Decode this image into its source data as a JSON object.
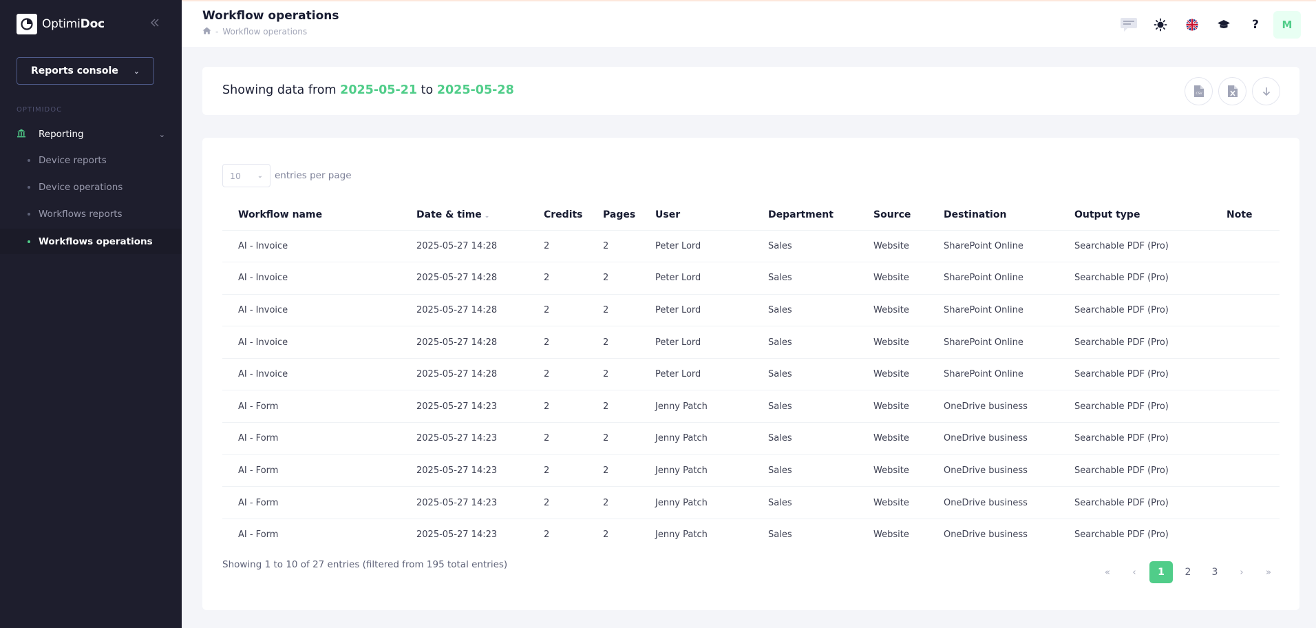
{
  "sidebar": {
    "brand_light": "Optimi",
    "brand_bold": "Doc",
    "console_label": "Reports console",
    "section_label": "OPTIMIDOC",
    "parent_label": "Reporting",
    "items": [
      {
        "label": "Device reports"
      },
      {
        "label": "Device operations"
      },
      {
        "label": "Workflows reports"
      },
      {
        "label": "Workflows operations",
        "active": true
      }
    ]
  },
  "header": {
    "title": "Workflow operations",
    "breadcrumb_sep": "-",
    "breadcrumb_current": "Workflow operations",
    "help_label": "?",
    "avatar_initial": "M"
  },
  "date_range": {
    "prefix": "Showing data from",
    "from": "2025-05-21",
    "mid": "to",
    "to": "2025-05-28"
  },
  "table": {
    "per_page_value": "10",
    "per_page_label": "entries per page",
    "columns": [
      "Workflow name",
      "Date & time",
      "Credits",
      "Pages",
      "User",
      "Department",
      "Source",
      "Destination",
      "Output type",
      "Note"
    ],
    "rows": [
      [
        "AI - Invoice",
        "2025-05-27 14:28",
        "2",
        "2",
        "Peter Lord",
        "Sales",
        "Website",
        "SharePoint Online",
        "Searchable PDF (Pro)",
        ""
      ],
      [
        "AI - Invoice",
        "2025-05-27 14:28",
        "2",
        "2",
        "Peter Lord",
        "Sales",
        "Website",
        "SharePoint Online",
        "Searchable PDF (Pro)",
        ""
      ],
      [
        "AI - Invoice",
        "2025-05-27 14:28",
        "2",
        "2",
        "Peter Lord",
        "Sales",
        "Website",
        "SharePoint Online",
        "Searchable PDF (Pro)",
        ""
      ],
      [
        "AI - Invoice",
        "2025-05-27 14:28",
        "2",
        "2",
        "Peter Lord",
        "Sales",
        "Website",
        "SharePoint Online",
        "Searchable PDF (Pro)",
        ""
      ],
      [
        "AI - Invoice",
        "2025-05-27 14:28",
        "2",
        "2",
        "Peter Lord",
        "Sales",
        "Website",
        "SharePoint Online",
        "Searchable PDF (Pro)",
        ""
      ],
      [
        "AI - Form",
        "2025-05-27 14:23",
        "2",
        "2",
        "Jenny Patch",
        "Sales",
        "Website",
        "OneDrive business",
        "Searchable PDF (Pro)",
        ""
      ],
      [
        "AI - Form",
        "2025-05-27 14:23",
        "2",
        "2",
        "Jenny Patch",
        "Sales",
        "Website",
        "OneDrive business",
        "Searchable PDF (Pro)",
        ""
      ],
      [
        "AI - Form",
        "2025-05-27 14:23",
        "2",
        "2",
        "Jenny Patch",
        "Sales",
        "Website",
        "OneDrive business",
        "Searchable PDF (Pro)",
        ""
      ],
      [
        "AI - Form",
        "2025-05-27 14:23",
        "2",
        "2",
        "Jenny Patch",
        "Sales",
        "Website",
        "OneDrive business",
        "Searchable PDF (Pro)",
        ""
      ],
      [
        "AI - Form",
        "2025-05-27 14:23",
        "2",
        "2",
        "Jenny Patch",
        "Sales",
        "Website",
        "OneDrive business",
        "Searchable PDF (Pro)",
        ""
      ]
    ],
    "info": "Showing 1 to 10 of 27 entries (filtered from 195 total entries)"
  },
  "pagination": {
    "pages": [
      "1",
      "2",
      "3"
    ],
    "active": "1"
  },
  "colors": {
    "accent": "#50cd89",
    "sidebar_bg": "#1e1e2d"
  }
}
